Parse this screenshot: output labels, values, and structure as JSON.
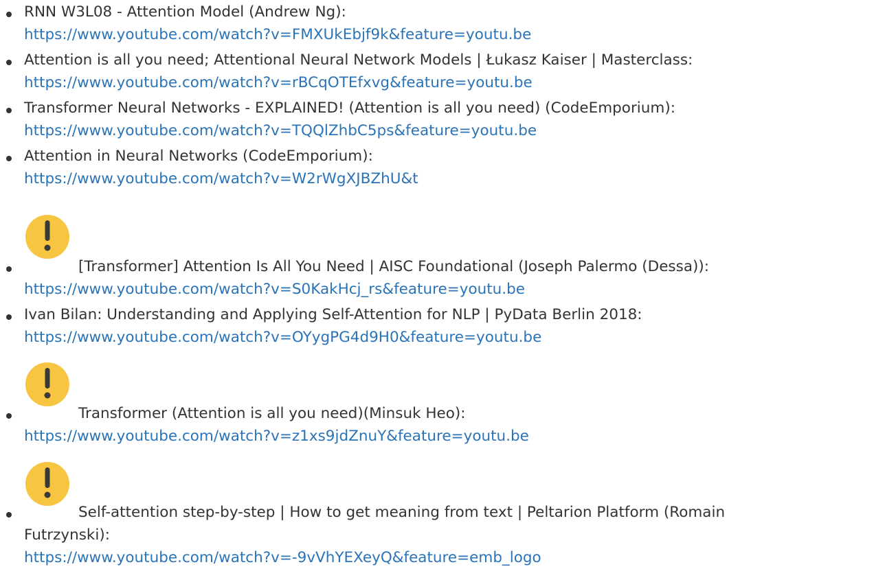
{
  "references": [
    {
      "title": "RNN W3L08 - Attention Model (Andrew Ng):",
      "url": "https://www.youtube.com/watch?v=FMXUkEbjf9k&feature=youtu.be",
      "icon": null
    },
    {
      "title": "Attention is all you need; Attentional Neural Network Models | Łukasz Kaiser | Masterclass:",
      "url": "https://www.youtube.com/watch?v=rBCqOTEfxvg&feature=youtu.be",
      "icon": null
    },
    {
      "title": "Transformer Neural Networks - EXPLAINED! (Attention is all you need) (CodeEmporium):",
      "url": "https://www.youtube.com/watch?v=TQQlZhbC5ps&feature=youtu.be",
      "icon": null
    },
    {
      "title": "Attention in Neural Networks (CodeEmporium):",
      "url": "https://www.youtube.com/watch?v=W2rWgXJBZhU&t",
      "icon": null
    },
    {
      "title": "[Transformer] Attention Is All You Need | AISC Foundational (Joseph Palermo (Dessa)):",
      "url": "https://www.youtube.com/watch?v=S0KakHcj_rs&feature=youtu.be",
      "icon": "important-icon"
    },
    {
      "title": "Ivan Bilan: Understanding and Applying Self-Attention for NLP | PyData Berlin 2018:",
      "url": "https://www.youtube.com/watch?v=OYygPG4d9H0&feature=youtu.be",
      "icon": null
    },
    {
      "title": "Transformer (Attention is all you need)(Minsuk Heo):",
      "url": "https://www.youtube.com/watch?v=z1xs9jdZnuY&feature=youtu.be",
      "icon": "important-icon"
    },
    {
      "title_line1": "Self-attention step-by-step | How to get meaning from text | Peltarion Platform (Romain",
      "title_line2": "Futrzynski):",
      "url": "https://www.youtube.com/watch?v=-9vVhYEXeyQ&feature=emb_logo",
      "icon": "important-icon"
    }
  ],
  "colors": {
    "text": "#333333",
    "link": "#2b73b7",
    "icon_fill": "#f7c542",
    "icon_mark": "#3a3a3a"
  }
}
